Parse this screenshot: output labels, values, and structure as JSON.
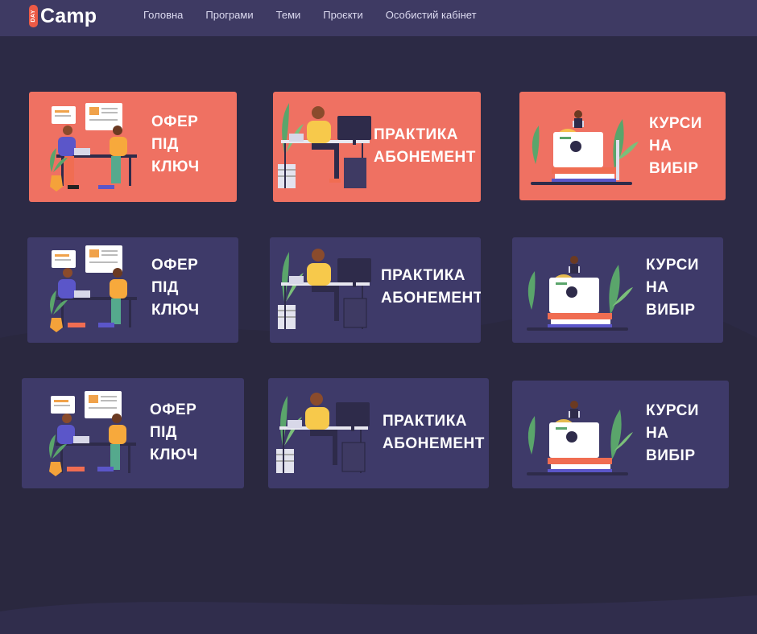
{
  "header": {
    "logo_badge": "DAY",
    "logo_text": "Camp",
    "nav": [
      "Головна",
      "Програми",
      "Теми",
      "Проєкти",
      "Особистий кабінет"
    ]
  },
  "cards": [
    {
      "lines": [
        "ОФЕР",
        "ПІД",
        "КЛЮЧ"
      ],
      "style": "orange",
      "illustration": "office-team-illustration"
    },
    {
      "lines": [
        "ПРАКТИКА",
        "АБОНЕМЕНТ"
      ],
      "style": "orange",
      "illustration": "developer-desk-illustration"
    },
    {
      "lines": [
        "КУРСИ",
        "НА",
        "ВИБІР"
      ],
      "style": "orange",
      "illustration": "courses-books-illustration"
    },
    {
      "lines": [
        "ОФЕР",
        "ПІД",
        "КЛЮЧ"
      ],
      "style": "purple",
      "illustration": "office-team-illustration"
    },
    {
      "lines": [
        "ПРАКТИКА",
        "АБОНЕМЕНТ"
      ],
      "style": "purple",
      "illustration": "developer-desk-illustration"
    },
    {
      "lines": [
        "КУРСИ",
        "НА",
        "ВИБІР"
      ],
      "style": "purple",
      "illustration": "courses-books-illustration"
    },
    {
      "lines": [
        "ОФЕР",
        "ПІД",
        "КЛЮЧ"
      ],
      "style": "purple",
      "illustration": "office-team-illustration"
    },
    {
      "lines": [
        "ПРАКТИКА",
        "АБОНЕМЕНТ"
      ],
      "style": "purple",
      "illustration": "developer-desk-illustration"
    },
    {
      "lines": [
        "КУРСИ",
        "НА",
        "ВИБІР"
      ],
      "style": "purple",
      "illustration": "courses-books-illustration"
    }
  ],
  "colors": {
    "accent": "#ef7162",
    "card_dark": "#3e3a69",
    "background": "#2c2a45",
    "header": "#3e3a63"
  }
}
